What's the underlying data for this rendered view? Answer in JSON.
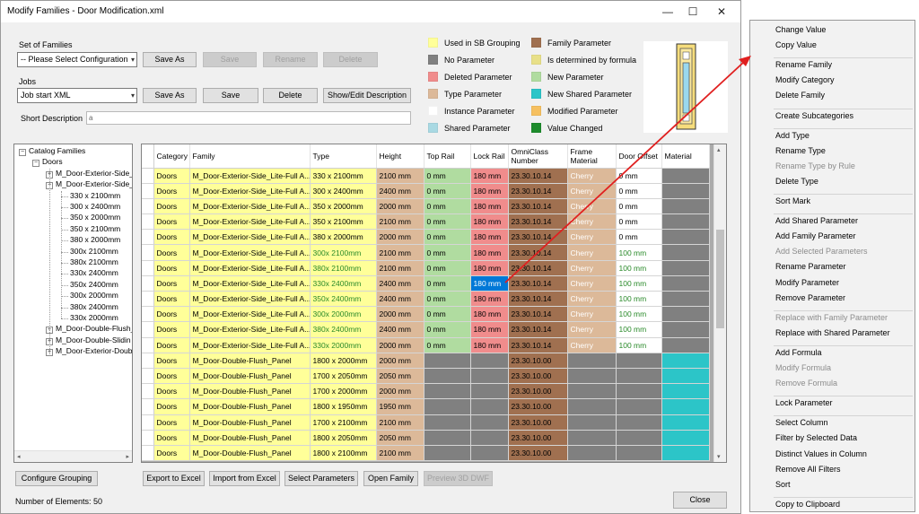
{
  "window": {
    "title": "Modify Families - Door Modification.xml",
    "minimize_glyph": "—",
    "maximize_glyph": "☐",
    "close_glyph": "✕"
  },
  "set_of_families": {
    "label": "Set of Families",
    "combo_value": "-- Please Select Configuration",
    "save_as": "Save As",
    "save": "Save",
    "rename": "Rename",
    "delete": "Delete"
  },
  "jobs": {
    "label": "Jobs",
    "combo_value": "Job start XML",
    "save_as": "Save As",
    "save": "Save",
    "delete": "Delete",
    "show_edit": "Show/Edit Description"
  },
  "short_description": {
    "label": "Short Description",
    "value": "a"
  },
  "legend": [
    {
      "label": "Used in SB Grouping",
      "color": "#ffff99"
    },
    {
      "label": "No Parameter",
      "color": "#808080"
    },
    {
      "label": "Deleted Parameter",
      "color": "#f08c8c"
    },
    {
      "label": "Type Parameter",
      "color": "#dcb999"
    },
    {
      "label": "Instance Parameter",
      "color": "#ffffff"
    },
    {
      "label": "Shared Parameter",
      "color": "#a9d9e3"
    },
    {
      "label": "Family Parameter",
      "color": "#a07050"
    },
    {
      "label": "Is determined by formula",
      "color": "#e8e089"
    },
    {
      "label": "New Parameter",
      "color": "#b0dca0"
    },
    {
      "label": "New Shared Parameter",
      "color": "#2cc5c8"
    },
    {
      "label": "Modified Parameter",
      "color": "#f6c060"
    },
    {
      "label": "Value Changed",
      "color": "#1e8c2d"
    }
  ],
  "tree": {
    "root": "Catalog Families",
    "category": "Doors",
    "families": [
      "M_Door-Exterior-Side_",
      "M_Door-Exterior-Side_",
      "M_Door-Double-Flush_",
      "M_Door-Double-Slidin",
      "M_Door-Exterior-Doub"
    ],
    "types": [
      "330 x 2100mm",
      "300 x 2400mm",
      "350 x 2000mm",
      "350 x 2100mm",
      "380 x 2000mm",
      "300x 2100mm",
      "380x 2100mm",
      "330x 2400mm",
      "350x 2400mm",
      "300x 2000mm",
      "380x 2400mm",
      "330x 2000mm"
    ]
  },
  "grid": {
    "columns": [
      "Category",
      "Family",
      "Type",
      "Height",
      "Top Rail",
      "Lock Rail",
      "OmniClass Number",
      "Frame Material",
      "Door Offset",
      "Material"
    ],
    "rows": [
      [
        "Doors",
        "M_Door-Exterior-Side_Lite-Full A...",
        "330 x 2100mm",
        "2100 mm",
        "0 mm",
        "180 mm",
        "23.30.10.14",
        "Cherry",
        "0 mm",
        ""
      ],
      [
        "Doors",
        "M_Door-Exterior-Side_Lite-Full A...",
        "300 x 2400mm",
        "2400 mm",
        "0 mm",
        "180 mm",
        "23.30.10.14",
        "Cherry",
        "0 mm",
        ""
      ],
      [
        "Doors",
        "M_Door-Exterior-Side_Lite-Full A...",
        "350 x 2000mm",
        "2000 mm",
        "0 mm",
        "180 mm",
        "23.30.10.14",
        "Cherry",
        "0 mm",
        ""
      ],
      [
        "Doors",
        "M_Door-Exterior-Side_Lite-Full A...",
        "350 x 2100mm",
        "2100 mm",
        "0 mm",
        "180 mm",
        "23.30.10.14",
        "Cherry",
        "0 mm",
        ""
      ],
      [
        "Doors",
        "M_Door-Exterior-Side_Lite-Full A...",
        "380 x 2000mm",
        "2000 mm",
        "0 mm",
        "180 mm",
        "23.30.10.14",
        "Cherry",
        "0 mm",
        ""
      ],
      [
        "Doors",
        "M_Door-Exterior-Side_Lite-Full A...",
        "300x 2100mm",
        "2100 mm",
        "0 mm",
        "180 mm",
        "23.30.10.14",
        "Cherry",
        "100 mm",
        ""
      ],
      [
        "Doors",
        "M_Door-Exterior-Side_Lite-Full A...",
        "380x 2100mm",
        "2100 mm",
        "0 mm",
        "180 mm",
        "23.30.10.14",
        "Cherry",
        "100 mm",
        ""
      ],
      [
        "Doors",
        "M_Door-Exterior-Side_Lite-Full A...",
        "330x 2400mm",
        "2400 mm",
        "0 mm",
        "180 mm",
        "23.30.10.14",
        "Cherry",
        "100 mm",
        ""
      ],
      [
        "Doors",
        "M_Door-Exterior-Side_Lite-Full A...",
        "350x 2400mm",
        "2400 mm",
        "0 mm",
        "180 mm",
        "23.30.10.14",
        "Cherry",
        "100 mm",
        ""
      ],
      [
        "Doors",
        "M_Door-Exterior-Side_Lite-Full A...",
        "300x 2000mm",
        "2000 mm",
        "0 mm",
        "180 mm",
        "23.30.10.14",
        "Cherry",
        "100 mm",
        ""
      ],
      [
        "Doors",
        "M_Door-Exterior-Side_Lite-Full A...",
        "380x 2400mm",
        "2400 mm",
        "0 mm",
        "180 mm",
        "23.30.10.14",
        "Cherry",
        "100 mm",
        ""
      ],
      [
        "Doors",
        "M_Door-Exterior-Side_Lite-Full A...",
        "330x 2000mm",
        "2000 mm",
        "0 mm",
        "180 mm",
        "23.30.10.14",
        "Cherry",
        "100 mm",
        ""
      ],
      [
        "Doors",
        "M_Door-Double-Flush_Panel",
        "1800 x 2000mm",
        "2000 mm",
        "",
        "",
        "23.30.10.00",
        "",
        "",
        ""
      ],
      [
        "Doors",
        "M_Door-Double-Flush_Panel",
        "1700 x 2050mm",
        "2050 mm",
        "",
        "",
        "23.30.10.00",
        "",
        "",
        ""
      ],
      [
        "Doors",
        "M_Door-Double-Flush_Panel",
        "1700 x 2000mm",
        "2000 mm",
        "",
        "",
        "23.30.10.00",
        "",
        "",
        ""
      ],
      [
        "Doors",
        "M_Door-Double-Flush_Panel",
        "1800 x 1950mm",
        "1950 mm",
        "",
        "",
        "23.30.10.00",
        "",
        "",
        ""
      ],
      [
        "Doors",
        "M_Door-Double-Flush_Panel",
        "1700 x 2100mm",
        "2100 mm",
        "",
        "",
        "23.30.10.00",
        "",
        "",
        ""
      ],
      [
        "Doors",
        "M_Door-Double-Flush_Panel",
        "1800 x 2050mm",
        "2050 mm",
        "",
        "",
        "23.30.10.00",
        "",
        "",
        ""
      ],
      [
        "Doors",
        "M_Door-Double-Flush_Panel",
        "1800 x 2100mm",
        "2100 mm",
        "",
        "",
        "23.30.10.00",
        "",
        "",
        ""
      ]
    ],
    "selected": {
      "row": 7,
      "col": 5
    }
  },
  "bottom": {
    "configure_grouping": "Configure Grouping",
    "export_excel": "Export to Excel",
    "import_excel": "Import from Excel",
    "select_parameters": "Select Parameters",
    "open_family": "Open Family",
    "preview": "Preview 3D DWF",
    "element_count": "Number of Elements: 50",
    "close": "Close"
  },
  "context_menu": [
    {
      "label": "Change Value",
      "enabled": true
    },
    {
      "label": "Copy Value",
      "enabled": true
    },
    {
      "sep": true
    },
    {
      "label": "Rename Family",
      "enabled": true
    },
    {
      "label": "Modify Category",
      "enabled": true
    },
    {
      "label": "Delete Family",
      "enabled": true
    },
    {
      "sep": true
    },
    {
      "label": "Create Subcategories",
      "enabled": true
    },
    {
      "sep": true
    },
    {
      "label": "Add Type",
      "enabled": true
    },
    {
      "label": "Rename Type",
      "enabled": true
    },
    {
      "label": "Rename Type by Rule",
      "enabled": false
    },
    {
      "label": "Delete Type",
      "enabled": true
    },
    {
      "sep": true
    },
    {
      "label": "Sort Mark",
      "enabled": true
    },
    {
      "sep": true
    },
    {
      "label": "Add Shared Parameter",
      "enabled": true
    },
    {
      "label": "Add Family Parameter",
      "enabled": true
    },
    {
      "label": "Add Selected Parameters",
      "enabled": false
    },
    {
      "label": "Rename Parameter",
      "enabled": true
    },
    {
      "label": "Modify Parameter",
      "enabled": true
    },
    {
      "label": "Remove Parameter",
      "enabled": true
    },
    {
      "sep": true
    },
    {
      "label": "Replace with Family Parameter",
      "enabled": false
    },
    {
      "label": "Replace with Shared Parameter",
      "enabled": true
    },
    {
      "sep": true
    },
    {
      "label": "Add Formula",
      "enabled": true
    },
    {
      "label": "Modify Formula",
      "enabled": false
    },
    {
      "label": "Remove Formula",
      "enabled": false
    },
    {
      "sep": true
    },
    {
      "label": "Lock Parameter",
      "enabled": true
    },
    {
      "sep": true
    },
    {
      "label": "Select Column",
      "enabled": true
    },
    {
      "label": "Filter by Selected Data",
      "enabled": true
    },
    {
      "label": "Distinct Values in Column",
      "enabled": true
    },
    {
      "label": "Remove All Filters",
      "enabled": true
    },
    {
      "label": "Sort",
      "enabled": true
    },
    {
      "sep": true
    },
    {
      "label": "Copy to Clipboard",
      "enabled": true
    }
  ],
  "colors": {
    "yellow": "#ffff99",
    "gray": "#808080",
    "red": "#f08c8c",
    "tan": "#dcb999",
    "brown": "#a07050",
    "green": "#b0dca0",
    "teal": "#2cc5c8",
    "selected": "#0078d7",
    "arrow": "#e02020"
  }
}
